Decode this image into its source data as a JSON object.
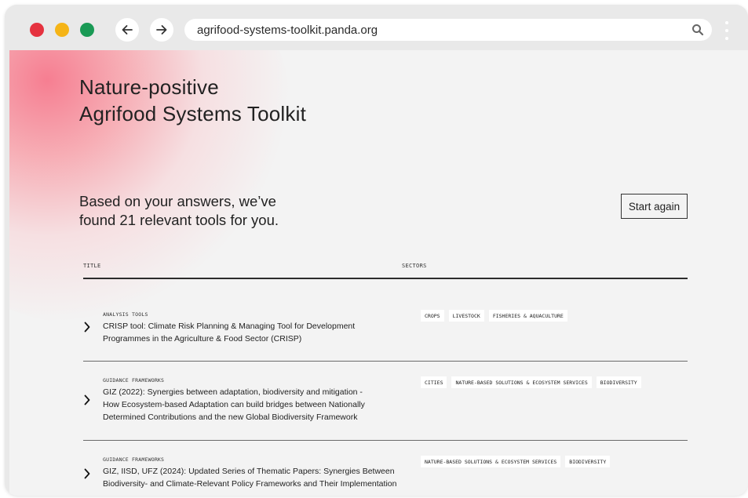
{
  "browser": {
    "url": "agrifood-systems-toolkit.panda.org",
    "icons": [
      "back-arrow-icon",
      "forward-arrow-icon",
      "search-icon",
      "more-options-icon"
    ],
    "colors": {
      "close": "#e5323f",
      "minimize": "#f5b417",
      "maximize": "#1a9a55"
    }
  },
  "page": {
    "title_line1": "Nature-positive",
    "title_line2": "Agrifood Systems Toolkit",
    "summary_line1": "Based on your answers, we’ve",
    "summary_line2": "found 21 relevant tools for you.",
    "start_again_label": "Start again"
  },
  "table": {
    "col_title": "TITLE",
    "col_sectors": "SECTORS",
    "rows": [
      {
        "category": "ANALYSIS TOOLS",
        "title_lines": [
          "CRISP tool: Climate Risk Planning & Managing Tool for Development",
          "Programmes in the Agriculture & Food Sector (CRISP)"
        ],
        "tags": [
          "CROPS",
          "LIVESTOCK",
          "FISHERIES & AQUACULTURE"
        ]
      },
      {
        "category": "GUIDANCE FRAMEWORKS",
        "title_lines": [
          "GIZ (2022): Synergies between adaptation, biodiversity and mitigation -",
          "How Ecosystem-based Adaptation can build bridges between Nationally",
          "Determined Contributions and the new Global Biodiversity Framework"
        ],
        "tags": [
          "CITIES",
          "NATURE-BASED SOLUTIONS & ECOSYSTEM SERVICES",
          "BIODIVERSITY"
        ]
      },
      {
        "category": "GUIDANCE FRAMEWORKS",
        "title_lines": [
          "GIZ, IISD, UFZ (2024): Updated Series of Thematic Papers: Synergies Between",
          "Biodiversity- and Climate-Relevant Policy Frameworks and Their Implementation"
        ],
        "tags": [
          "NATURE-BASED SOLUTIONS & ECOSYSTEM SERVICES",
          "BIODIVERSITY"
        ]
      }
    ]
  }
}
